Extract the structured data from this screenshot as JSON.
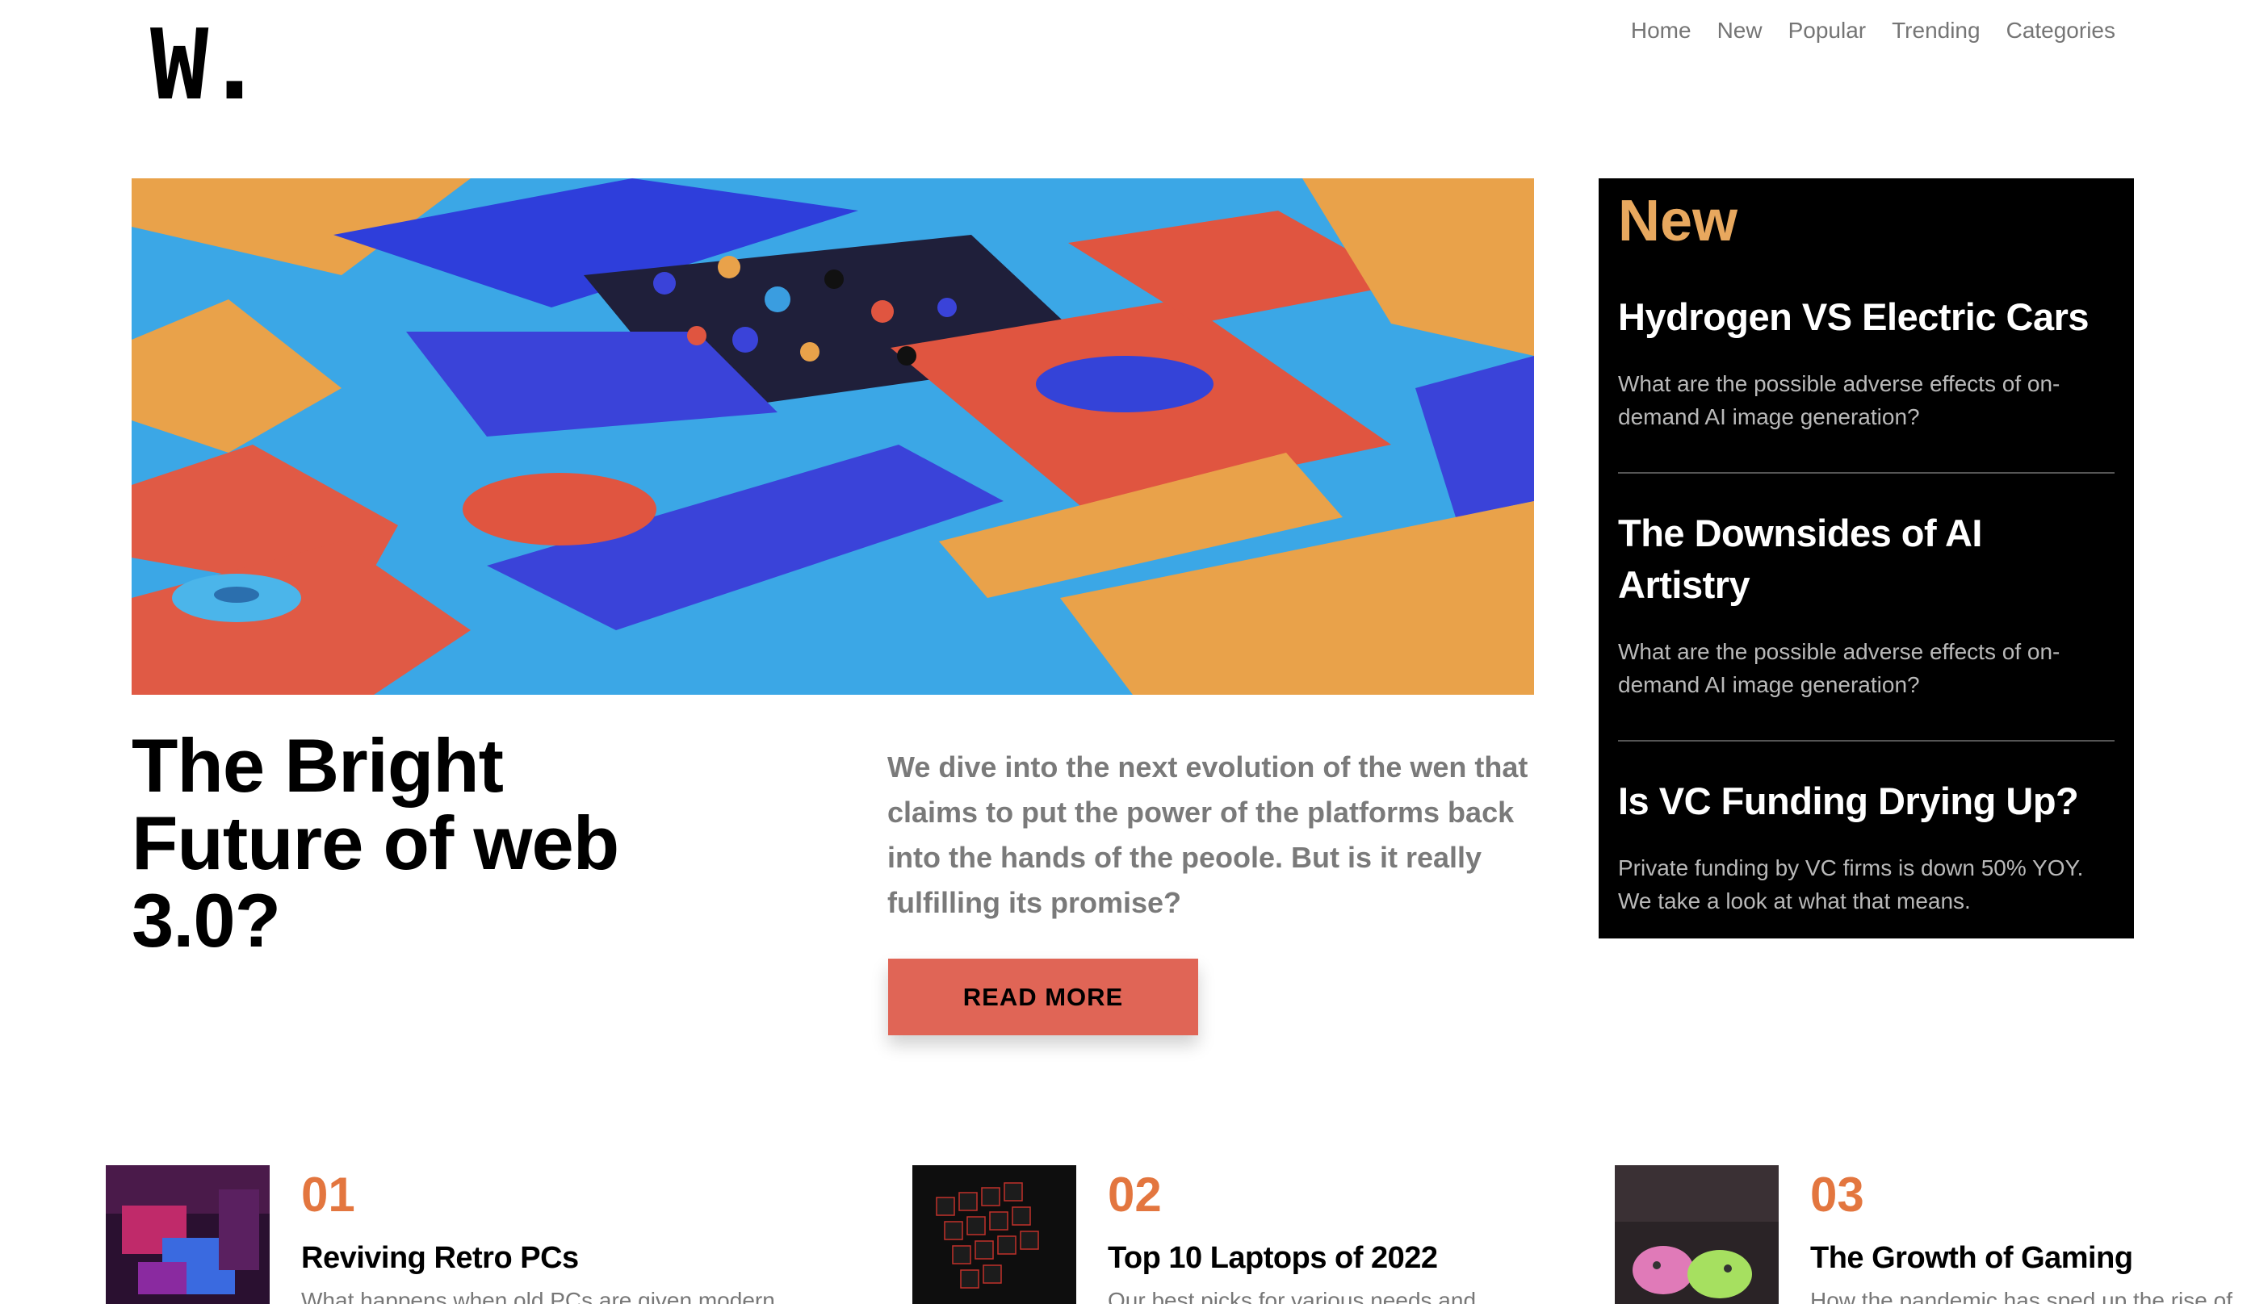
{
  "header": {
    "logo": "W.",
    "nav": [
      "Home",
      "New",
      "Popular",
      "Trending",
      "Categories"
    ]
  },
  "hero": {
    "title": "The Bright Future of web 3.0?",
    "description": "We dive into the next evolution of the wen that claims to put the power of the platforms back into the hands of the peoole. But is it really fulfilling its promise?",
    "button": "READ MORE"
  },
  "sidebar": {
    "title": "New",
    "items": [
      {
        "title": "Hydrogen VS Electric Cars",
        "desc": "What are the possible adverse effects of on-demand AI image generation?"
      },
      {
        "title": "The Downsides of AI Artistry",
        "desc": "What are the possible adverse effects of on-demand AI image generation?"
      },
      {
        "title": "Is VC Funding Drying Up?",
        "desc": "Private funding by VC firms is down 50% YOY. We take a look at what that means."
      }
    ]
  },
  "cards": [
    {
      "num": "01",
      "title": "Reviving Retro PCs",
      "desc": "What happens when old PCs are given modern..."
    },
    {
      "num": "02",
      "title": "Top 10 Laptops of 2022",
      "desc": "Our best picks for various needs and..."
    },
    {
      "num": "03",
      "title": "The Growth of Gaming",
      "desc": "How the pandemic has sped up the rise of..."
    }
  ],
  "colors": {
    "accent_orange": "#e3763f",
    "button_red": "#e06556",
    "sidebar_heading": "#e8a85e"
  }
}
